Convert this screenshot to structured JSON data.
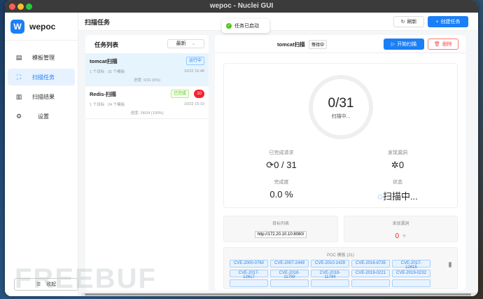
{
  "window": {
    "title": "wepoc - Nuclei GUI"
  },
  "sidebar": {
    "logo_letter": "W",
    "app_name": "wepoc",
    "items": [
      {
        "icon": "file-icon",
        "label": "模板管理"
      },
      {
        "icon": "scan-icon",
        "label": "扫描任务",
        "active": true
      },
      {
        "icon": "chart-icon",
        "label": "扫描结果"
      },
      {
        "icon": "gear-icon",
        "label": "设置"
      }
    ],
    "collapse_label": "收起"
  },
  "header": {
    "title": "扫描任务",
    "refresh_label": "刷新",
    "create_label": "创建任务"
  },
  "toast": {
    "text": "任务已启动"
  },
  "task_list": {
    "title": "任务列表",
    "sort": "最新",
    "items": [
      {
        "name": "tomcat扫描",
        "status": "运行中",
        "meta": "1 个目标 · 31 个模板",
        "date": "10/22 16:48",
        "progress": "进度: 0/31 (0%)"
      },
      {
        "name": "Redis-扫描",
        "status": "已完成",
        "count": "10",
        "meta": "1 个目标 · 24 个模板",
        "date": "10/22 15:10",
        "progress": "进度: 24/24 (100%)"
      }
    ]
  },
  "detail": {
    "name": "tomcat扫描",
    "status": "等待中",
    "start_label": "开始扫描",
    "delete_label": "删除",
    "ring": {
      "value": "0/31",
      "label": "扫描中...",
      "progress": 0
    },
    "stats": {
      "requests_label": "已完成请求",
      "requests_value": "0 / 31",
      "vulns_label": "发现漏洞",
      "vulns_value": "0",
      "completion_label": "完成度",
      "completion_value": "0.0 %",
      "state_label": "状态",
      "state_value": "扫描中..."
    },
    "targets": {
      "label": "目标列表",
      "value": "http://172.20.10.10:8080/"
    },
    "found": {
      "label": "发现漏洞",
      "value": "0",
      "unit": "个"
    },
    "poc": {
      "label": "POC 模板 (31)",
      "tags": [
        "CVE-2000-0760",
        "CVE-2007-2449",
        "CVE-2010-1429",
        "CVE-2016-8735",
        "CVE-2017-12615",
        "CVE-2017-12617",
        "CVE-2018-11759",
        "CVE-2018-11784",
        "CVE-2019-0221",
        "CVE-2019-0232"
      ]
    }
  },
  "colors": {
    "primary": "#1b7ff5",
    "danger": "#f5222d",
    "success": "#52c41a"
  }
}
